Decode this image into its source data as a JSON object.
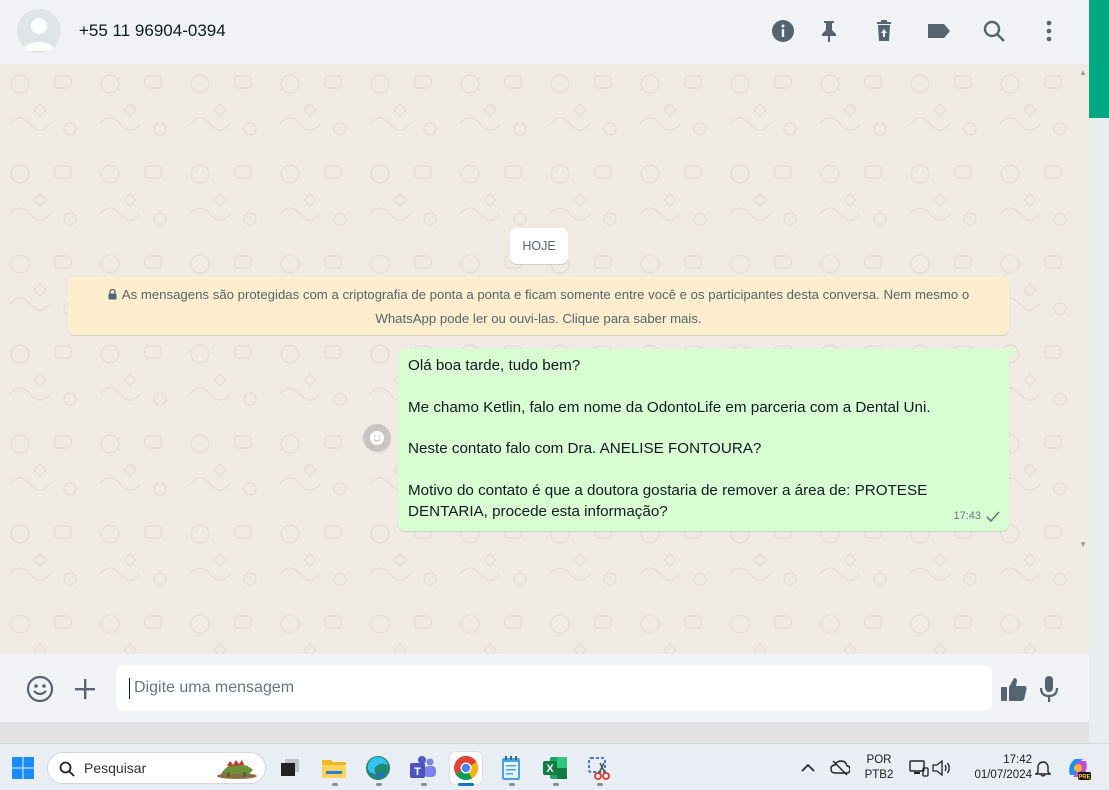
{
  "header": {
    "contact_name": "+55 11 96904-0394",
    "icons": [
      "info-icon",
      "pin-icon",
      "delete-icon",
      "label-icon",
      "search-icon",
      "menu-icon"
    ]
  },
  "chat": {
    "date_label": "HOJE",
    "encryption_notice": "As mensagens são protegidas com a criptografia de ponta a ponta e ficam somente entre você e os participantes desta conversa. Nem mesmo o WhatsApp pode ler ou ouvi-las. Clique para saber mais.",
    "message": {
      "lines": [
        "Olá boa tarde, tudo bem?",
        "Me chamo Ketlin, falo em nome da OdontoLife em parceria com a Dental Uni.",
        "Neste contato falo com Dra. ANELISE FONTOURA?",
        "Motivo do contato é que a doutora gostaria de remover a área de: PROTESE DENTARIA, procede esta informação?"
      ],
      "time": "17:43",
      "status": "sent-single-check"
    }
  },
  "composer": {
    "placeholder": "Digite uma mensagem"
  },
  "taskbar": {
    "search_placeholder": "Pesquisar",
    "apps": [
      "start-icon",
      "task-view-icon",
      "file-explorer-icon",
      "edge-icon",
      "teams-icon",
      "chrome-icon",
      "notepad-icon",
      "excel-icon",
      "snipping-tool-icon"
    ],
    "active_app": "chrome-icon",
    "language_line1": "POR",
    "language_line2": "PTB2",
    "clock_time": "17:42",
    "clock_date": "01/07/2024"
  },
  "colors": {
    "accent": "#00a884",
    "outgoing_bubble": "#d9fdd3",
    "encryption_bg": "#ffeecd",
    "chat_bg": "#efeae2"
  }
}
